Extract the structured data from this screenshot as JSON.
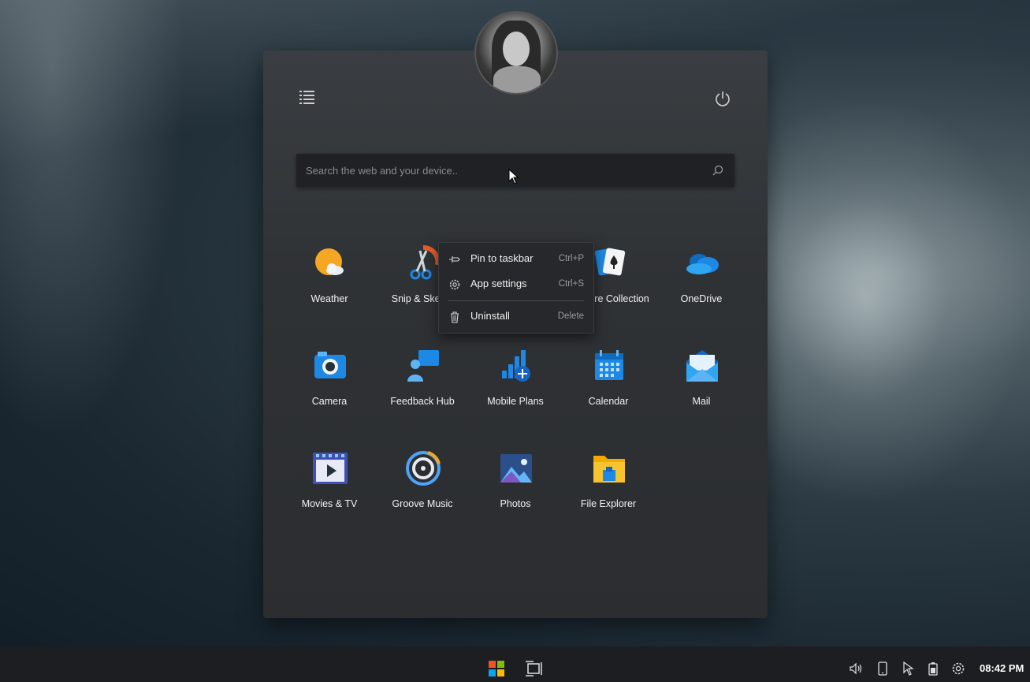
{
  "search": {
    "placeholder": "Search the web and your device.."
  },
  "apps": [
    {
      "label": "Weather",
      "icon": "weather-icon"
    },
    {
      "label": "Snip & Sketch",
      "icon": "snip-sketch-icon"
    },
    {
      "label": "Solitaire Collection",
      "icon": "solitaire-icon"
    },
    {
      "label": "OneDrive",
      "icon": "onedrive-icon"
    },
    {
      "label": "Camera",
      "icon": "camera-icon"
    },
    {
      "label": "Feedback Hub",
      "icon": "feedback-hub-icon"
    },
    {
      "label": "Mobile Plans",
      "icon": "mobile-plans-icon"
    },
    {
      "label": "Calendar",
      "icon": "calendar-icon"
    },
    {
      "label": "Mail",
      "icon": "mail-icon"
    },
    {
      "label": "Movies & TV",
      "icon": "movies-tv-icon"
    },
    {
      "label": "Groove Music",
      "icon": "groove-music-icon"
    },
    {
      "label": "Photos",
      "icon": "photos-icon"
    },
    {
      "label": "File Explorer",
      "icon": "file-explorer-icon"
    }
  ],
  "context_menu": {
    "items": [
      {
        "label": "Pin to taskbar",
        "shortcut": "Ctrl+P",
        "icon": "pin-icon"
      },
      {
        "label": "App settings",
        "shortcut": "Ctrl+S",
        "icon": "gear-icon"
      },
      {
        "label": "Uninstall",
        "shortcut": "Delete",
        "icon": "trash-icon"
      }
    ]
  },
  "taskbar": {
    "clock": "08:42 PM",
    "tray_icons": [
      "volume-icon",
      "tablet-icon",
      "pointer-icon",
      "battery-icon",
      "settings-icon"
    ]
  },
  "colors": {
    "accent_blue": "#1e88e5",
    "weather_sun": "#f5a623",
    "file_explorer_yellow": "#f7c32e"
  }
}
